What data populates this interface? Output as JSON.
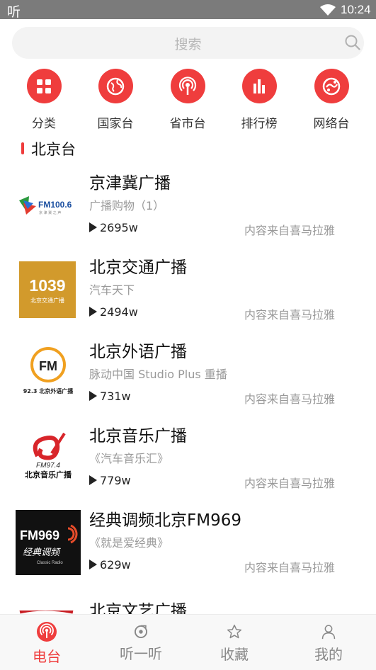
{
  "status_bar": {
    "app_glyph": "听",
    "time": "10:24"
  },
  "search": {
    "placeholder": "搜索"
  },
  "categories": [
    {
      "label": "分类",
      "icon": "grid-icon"
    },
    {
      "label": "国家台",
      "icon": "globe-icon"
    },
    {
      "label": "省市台",
      "icon": "broadcast-icon"
    },
    {
      "label": "排行榜",
      "icon": "bar-chart-icon"
    },
    {
      "label": "网络台",
      "icon": "network-icon"
    }
  ],
  "section_title": "北京台",
  "stations": [
    {
      "name": "京津冀广播",
      "subtitle": "广播购物（1）",
      "plays": "2695w",
      "source": "内容来自喜马拉雅",
      "logo_text": "FM100.6"
    },
    {
      "name": "北京交通广播",
      "subtitle": "汽车天下",
      "plays": "2494w",
      "source": "内容来自喜马拉雅",
      "logo_text": "1039",
      "logo_sub": "北京交通广播"
    },
    {
      "name": "北京外语广播",
      "subtitle": "脉动中国 Studio Plus 重播",
      "plays": "731w",
      "source": "内容来自喜马拉雅",
      "logo_text": "FM",
      "logo_sub": "92.3 北京外语广播"
    },
    {
      "name": "北京音乐广播",
      "subtitle": "《汽车音乐汇》",
      "plays": "779w",
      "source": "内容来自喜马拉雅",
      "logo_text": "FM97.4",
      "logo_sub": "北京音乐广播"
    },
    {
      "name": "经典调频北京FM969",
      "subtitle": "《就是爱经典》",
      "plays": "629w",
      "source": "内容来自喜马拉雅",
      "logo_text": "FM969",
      "logo_sub": "经典调频"
    },
    {
      "name": "北京文艺广播",
      "subtitle": "",
      "plays": "",
      "source": ""
    }
  ],
  "tabs": [
    {
      "label": "电台",
      "icon": "radio-icon",
      "active": true
    },
    {
      "label": "听一听",
      "icon": "listen-icon",
      "active": false
    },
    {
      "label": "收藏",
      "icon": "star-icon",
      "active": false
    },
    {
      "label": "我的",
      "icon": "person-icon",
      "active": false
    }
  ],
  "colors": {
    "accent": "#ef3d3d",
    "status_bar": "#7b7b7b"
  }
}
